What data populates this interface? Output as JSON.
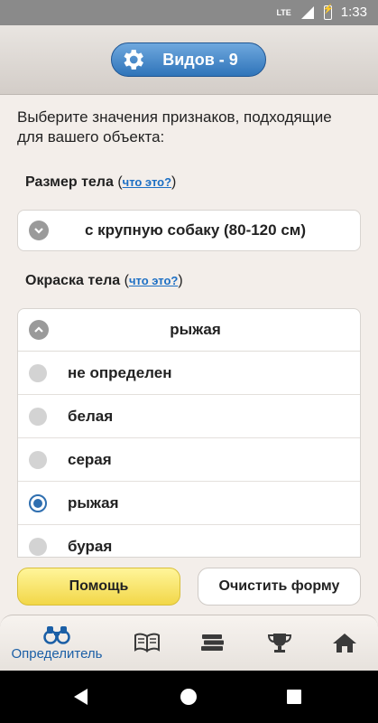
{
  "status_bar": {
    "network": "LTE",
    "time": "1:33"
  },
  "header": {
    "species_button": "Видов - 9"
  },
  "intro": "Выберите значения признаков, подходящие для вашего объекта:",
  "body_size": {
    "label": "Размер тела",
    "help_link": "что это?",
    "selected": "с крупную собаку (80-120 см)"
  },
  "body_color": {
    "label": "Окраска тела",
    "help_link": "что это?",
    "selected": "рыжая",
    "options": [
      {
        "label": "не определен",
        "checked": false
      },
      {
        "label": "белая",
        "checked": false
      },
      {
        "label": "серая",
        "checked": false
      },
      {
        "label": "рыжая",
        "checked": true
      },
      {
        "label": "бурая",
        "checked": false
      }
    ]
  },
  "buttons": {
    "help": "Помощь",
    "clear": "Очистить форму"
  },
  "tabs": {
    "identifier": "Определитель"
  },
  "colors": {
    "accent": "#2f74b9",
    "help_button": "#f2d748",
    "link": "#1c6fc4"
  }
}
